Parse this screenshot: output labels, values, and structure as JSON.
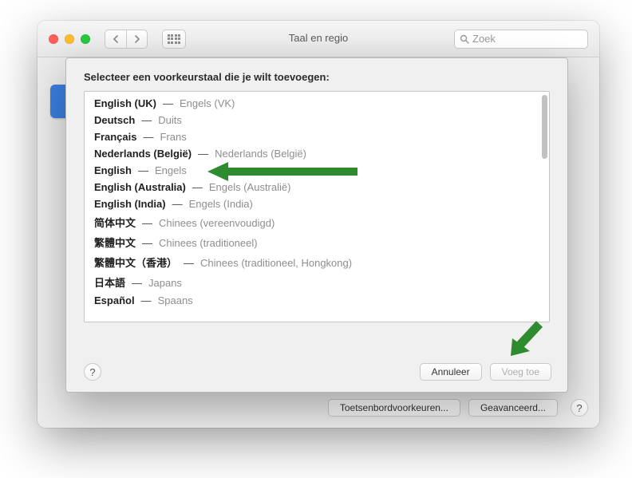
{
  "window": {
    "title": "Taal en regio",
    "search_placeholder": "Zoek"
  },
  "bottom": {
    "keyboard_btn": "Toetsenbordvoorkeuren...",
    "advanced_btn": "Geavanceerd..."
  },
  "sheet": {
    "heading": "Selecteer een voorkeurstaal die je wilt toevoegen:",
    "cancel": "Annuleer",
    "add": "Voeg toe",
    "help": "?",
    "languages": [
      {
        "native": "English (UK)",
        "translated": "Engels (VK)"
      },
      {
        "native": "Deutsch",
        "translated": "Duits"
      },
      {
        "native": "Français",
        "translated": "Frans"
      },
      {
        "native": "Nederlands (België)",
        "translated": "Nederlands (België)"
      },
      {
        "native": "English",
        "translated": "Engels"
      },
      {
        "native": "English (Australia)",
        "translated": "Engels (Australië)"
      },
      {
        "native": "English (India)",
        "translated": "Engels (India)"
      },
      {
        "native": "简体中文",
        "translated": "Chinees (vereenvoudigd)"
      },
      {
        "native": "繁體中文",
        "translated": "Chinees (traditioneel)"
      },
      {
        "native": "繁體中文（香港）",
        "translated": "Chinees (traditioneel, Hongkong)"
      },
      {
        "native": "日本語",
        "translated": "Japans"
      },
      {
        "native": "Español",
        "translated": "Spaans"
      }
    ]
  },
  "help_symbol": "?",
  "dash": "—"
}
